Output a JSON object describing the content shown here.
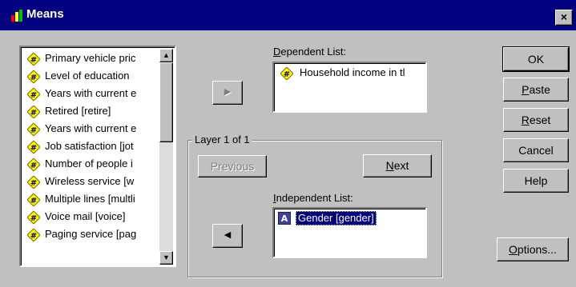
{
  "window": {
    "title": "Means",
    "close_label": "×"
  },
  "variables": [
    "Primary vehicle pric",
    "Level of education",
    "Years with current e",
    "Retired [retire]",
    "Years with current e",
    "Job satisfaction [jot",
    "Number of people i",
    "Wireless service [w",
    "Multiple lines [multli",
    "Voice mail [voice]",
    "Paging service [pag"
  ],
  "scrollbar": {
    "up": "▲",
    "down": "▼"
  },
  "dependent": {
    "label_prefix": "",
    "label_mnemonic": "D",
    "label_rest": "ependent List:",
    "items": [
      "Household income in tl"
    ]
  },
  "layer": {
    "legend": "Layer 1 of 1",
    "previous": "Previous",
    "previous_mnemonic": "v",
    "next_mnemonic": "N",
    "next_rest": "ext"
  },
  "independent": {
    "label_mnemonic": "I",
    "label_rest": "ndependent List:",
    "items": [
      "Gender [gender]"
    ]
  },
  "buttons": {
    "ok": "OK",
    "paste_m": "P",
    "paste_rest": "aste",
    "reset_m": "R",
    "reset_rest": "eset",
    "cancel": "Cancel",
    "help": "Help",
    "options_m": "O",
    "options_rest": "ptions..."
  },
  "arrows": {
    "move_right": "▶",
    "move_left": "◀"
  },
  "colors": {
    "titlebar": "#000080",
    "face": "#c0c0c0",
    "selection": "#000080"
  }
}
